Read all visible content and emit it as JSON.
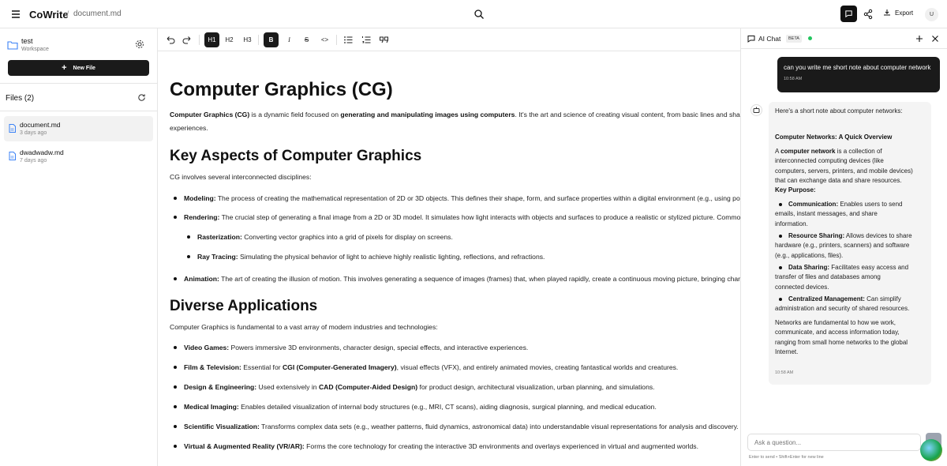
{
  "header": {
    "app_name": "CoWrite",
    "separator": "/",
    "doc_name": "document.md",
    "export_label": "Export",
    "avatar_initial": "U"
  },
  "sidebar": {
    "workspace_name": "test",
    "workspace_sub": "Workspace",
    "new_file_label": "New File",
    "files_title": "Files (2)",
    "files": [
      {
        "name": "document.md",
        "date": "3 days ago"
      },
      {
        "name": "dwadwadw.md",
        "date": "7 days ago"
      }
    ]
  },
  "toolbar": {
    "h1": "H1",
    "h2": "H2",
    "h3": "H3",
    "bold": "B",
    "italic": "I",
    "strike": "S",
    "code": "<>"
  },
  "doc": {
    "title": "Computer Graphics (CG)",
    "intro_b1": "Computer Graphics (CG)",
    "intro_t1": " is a dynamic field focused on ",
    "intro_b2": "generating and manipulating images using computers",
    "intro_t2": ". It's the art and science of creating visual content, from basic lines and shapes to complex 3D environments and realistic",
    "intro_line2": "experiences.",
    "h2_1": "Key Aspects of Computer Graphics",
    "p1": "CG involves several interconnected disciplines:",
    "items1": [
      {
        "b": "Modeling:",
        "t": " The process of creating the mathematical representation of 2D or 3D objects. This defines their shape, form, and surface properties within a digital environment (e.g., using polygons, curves, or voxels)."
      },
      {
        "b": "Rendering:",
        "t": " The crucial step of generating a final image from a 2D or 3D model. It simulates how light interacts with objects and surfaces to produce a realistic or stylized picture. Common techniques include:"
      },
      {
        "b": "Rasterization:",
        "t": " Converting vector graphics into a grid of pixels for display on screens."
      },
      {
        "b": "Ray Tracing:",
        "t": " Simulating the physical behavior of light to achieve highly realistic lighting, reflections, and refractions."
      },
      {
        "b": "Animation:",
        "t": " The art of creating the illusion of motion. This involves generating a sequence of images (frames) that, when played rapidly, create a continuous moving picture, bringing characters and scenes to life."
      }
    ],
    "h2_2": "Diverse Applications",
    "p2": "Computer Graphics is fundamental to a vast array of modern industries and technologies:",
    "items2": [
      {
        "b": "Video Games:",
        "t": " Powers immersive 3D environments, character design, special effects, and interactive experiences."
      },
      {
        "b": "Film & Television:",
        "t": " Essential for ",
        "b2": "CGI (Computer-Generated Imagery)",
        "t2": ", visual effects (VFX), and entirely animated movies, creating fantastical worlds and creatures."
      },
      {
        "b": "Design & Engineering:",
        "t": " Used extensively in ",
        "b2": "CAD (Computer-Aided Design)",
        "t2": " for product design, architectural visualization, urban planning, and simulations."
      },
      {
        "b": "Medical Imaging:",
        "t": " Enables detailed visualization of internal body structures (e.g., MRI, CT scans), aiding diagnosis, surgical planning, and medical education."
      },
      {
        "b": "Scientific Visualization:",
        "t": " Transforms complex data sets (e.g., weather patterns, fluid dynamics, astronomical data) into understandable visual representations for analysis and discovery."
      },
      {
        "b": "Virtual & Augmented Reality (VR/AR):",
        "t": " Forms the core technology for creating the interactive 3D environments and overlays experienced in virtual and augmented worlds."
      }
    ]
  },
  "chat": {
    "title": "AI Chat",
    "beta": "BETA",
    "user_msg": "can you write me short note about computer network",
    "user_time": "10:58 AM",
    "bot_intro": "Here's a short note about computer networks:",
    "bot_heading": "Computer Networks: A Quick Overview",
    "bot_p1_a": "A ",
    "bot_p1_b": "computer network",
    "bot_p1_c": " is a collection of",
    "bot_p1_l2": "interconnected computing devices (like",
    "bot_p1_l3": "computers, servers, printers, and mobile devices)",
    "bot_p1_l4": "that can exchange data and share resources.",
    "bot_key": "Key Purpose:",
    "bullets": [
      {
        "b": "Communication:",
        "l1": " Enables users to send",
        "l2": "emails, instant messages, and share",
        "l3": "information."
      },
      {
        "b": "Resource Sharing:",
        "l1": " Allows devices to share",
        "l2": "hardware (e.g., printers, scanners) and software",
        "l3": "(e.g., applications, files)."
      },
      {
        "b": "Data Sharing:",
        "l1": " Facilitates easy access and",
        "l2": "transfer of files and databases among",
        "l3": "connected devices."
      },
      {
        "b": "Centralized Management:",
        "l1": " Can simplify",
        "l2": "administration and security of shared resources.",
        "l3": ""
      }
    ],
    "bot_outro_l1": "Networks are fundamental to how we work,",
    "bot_outro_l2": "communicate, and access information today,",
    "bot_outro_l3": "ranging from small home networks to the global",
    "bot_outro_l4": "Internet.",
    "bot_time": "10:58 AM",
    "input_placeholder": "Ask a question...",
    "hint": "Enter to send • Shift+Enter for new line"
  }
}
